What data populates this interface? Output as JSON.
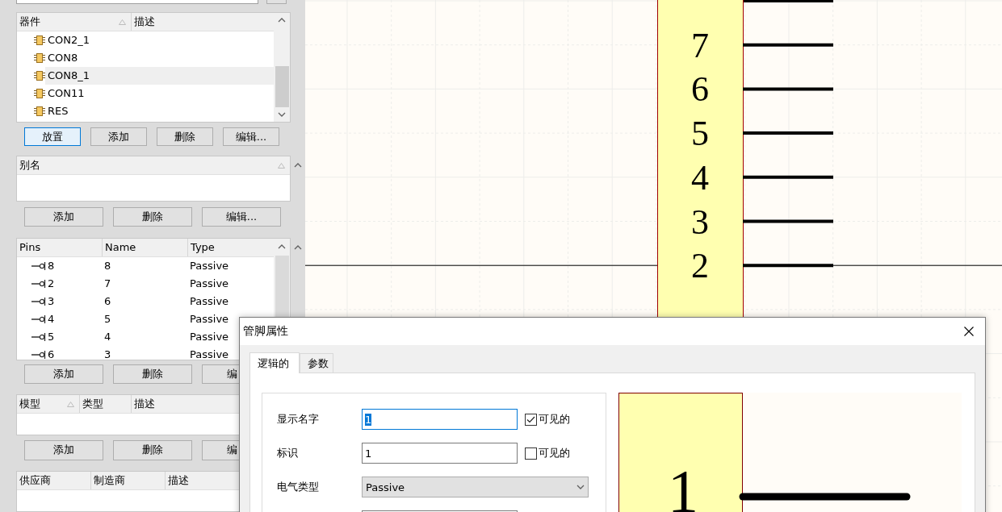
{
  "library": {
    "components": {
      "columns": [
        {
          "label": "器件",
          "sorted": true
        },
        {
          "label": "描述",
          "sorted": false
        }
      ],
      "rows": [
        {
          "name": "CON2_1",
          "selected": false
        },
        {
          "name": "CON8",
          "selected": false
        },
        {
          "name": "CON8_1",
          "selected": true
        },
        {
          "name": "CON11",
          "selected": false
        },
        {
          "name": "RES",
          "selected": false
        }
      ]
    },
    "component_buttons": [
      {
        "label": "放置",
        "focused": true
      },
      {
        "label": "添加",
        "focused": false
      },
      {
        "label": "删除",
        "focused": false
      },
      {
        "label": "编辑...",
        "focused": false
      }
    ],
    "aliases": {
      "columns": [
        {
          "label": "别名",
          "sorted": true
        }
      ]
    },
    "alias_buttons": [
      {
        "label": "添加",
        "focused": false
      },
      {
        "label": "删除",
        "focused": false
      },
      {
        "label": "编辑...",
        "focused": false
      }
    ],
    "pins": {
      "columns": [
        {
          "label": "Pins",
          "sorted": false
        },
        {
          "label": "Name",
          "sorted": false
        },
        {
          "label": "Type",
          "sorted": false
        }
      ],
      "rows": [
        {
          "pin": "8",
          "name": "8",
          "type": "Passive"
        },
        {
          "pin": "2",
          "name": "7",
          "type": "Passive"
        },
        {
          "pin": "3",
          "name": "6",
          "type": "Passive"
        },
        {
          "pin": "4",
          "name": "5",
          "type": "Passive"
        },
        {
          "pin": "5",
          "name": "4",
          "type": "Passive"
        },
        {
          "pin": "6",
          "name": "3",
          "type": "Passive"
        }
      ]
    },
    "pin_buttons": [
      {
        "label": "添加",
        "focused": false
      },
      {
        "label": "删除",
        "focused": false
      },
      {
        "label": "编",
        "focused": false
      }
    ],
    "models": {
      "columns": [
        {
          "label": "模型",
          "sorted": true
        },
        {
          "label": "类型",
          "sorted": false
        },
        {
          "label": "描述"
        }
      ]
    },
    "model_buttons": [
      {
        "label": "添加",
        "focused": false
      },
      {
        "label": "删除",
        "focused": false
      },
      {
        "label": "编",
        "focused": false
      }
    ],
    "suppliers": {
      "columns": [
        {
          "label": "供应商",
          "sorted": false
        },
        {
          "label": "制造商",
          "sorted": false
        },
        {
          "label": "描述"
        }
      ]
    }
  },
  "schematic": {
    "pin_numbers": [
      "7",
      "6",
      "5",
      "4",
      "3",
      "2"
    ]
  },
  "dialog": {
    "title": "管脚属性",
    "tabs": [
      {
        "label": "逻辑的",
        "selected": true
      },
      {
        "label": "参数",
        "selected": false
      }
    ],
    "fields": [
      {
        "kind": "text",
        "label": "显示名字",
        "value": "1",
        "focused": true,
        "visible": {
          "label": "可见的",
          "checked": true
        }
      },
      {
        "kind": "text",
        "label": "标识",
        "value": "1",
        "focused": false,
        "visible": {
          "label": "可见的",
          "checked": false
        }
      },
      {
        "kind": "dropdown",
        "label": "电气类型",
        "value": "Passive"
      },
      {
        "kind": "text",
        "focused": false
      }
    ],
    "preview": {
      "pin_number": "1"
    }
  }
}
